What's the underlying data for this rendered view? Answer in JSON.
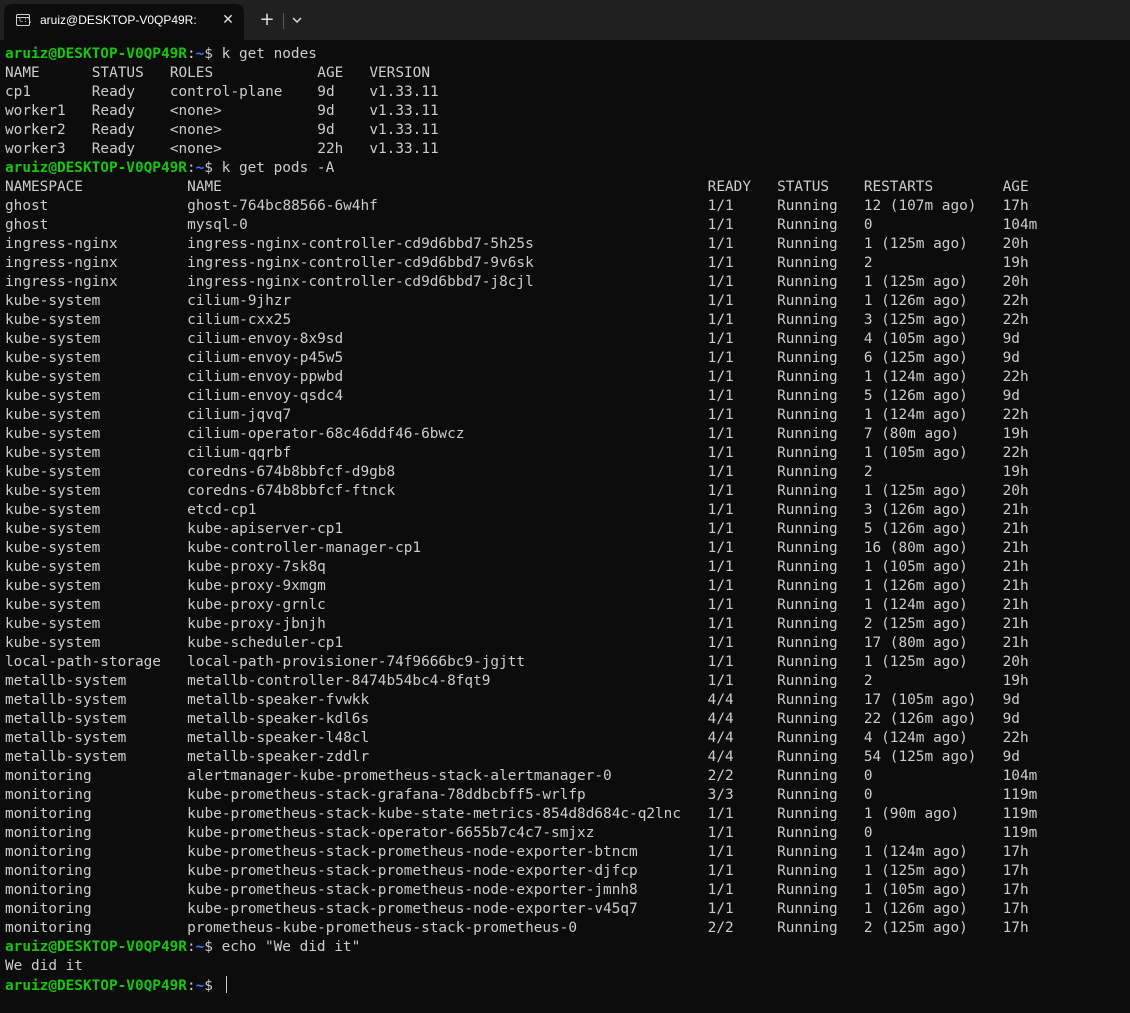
{
  "window": {
    "tab_title": "aruiz@DESKTOP-V0QP49R: ~",
    "tab_close": "✕",
    "new_tab": "+",
    "tab_icon_glyph": "C:\\"
  },
  "prompt": {
    "user_host": "aruiz@DESKTOP-V0QP49R",
    "path": "~",
    "symbol": "$ "
  },
  "commands": [
    "k get nodes",
    "k get pods -A",
    "echo \"We did it\""
  ],
  "nodes_table": {
    "headers": [
      "NAME",
      "STATUS",
      "ROLES",
      "AGE",
      "VERSION"
    ],
    "rows": [
      [
        "cp1",
        "Ready",
        "control-plane",
        "9d",
        "v1.33.11"
      ],
      [
        "worker1",
        "Ready",
        "<none>",
        "9d",
        "v1.33.11"
      ],
      [
        "worker2",
        "Ready",
        "<none>",
        "9d",
        "v1.33.11"
      ],
      [
        "worker3",
        "Ready",
        "<none>",
        "22h",
        "v1.33.11"
      ]
    ]
  },
  "pods_table": {
    "headers": [
      "NAMESPACE",
      "NAME",
      "READY",
      "STATUS",
      "RESTARTS",
      "AGE"
    ],
    "rows": [
      [
        "ghost",
        "ghost-764bc88566-6w4hf",
        "1/1",
        "Running",
        "12 (107m ago)",
        "17h"
      ],
      [
        "ghost",
        "mysql-0",
        "1/1",
        "Running",
        "0",
        "104m"
      ],
      [
        "ingress-nginx",
        "ingress-nginx-controller-cd9d6bbd7-5h25s",
        "1/1",
        "Running",
        "1 (125m ago)",
        "20h"
      ],
      [
        "ingress-nginx",
        "ingress-nginx-controller-cd9d6bbd7-9v6sk",
        "1/1",
        "Running",
        "2",
        "19h"
      ],
      [
        "ingress-nginx",
        "ingress-nginx-controller-cd9d6bbd7-j8cjl",
        "1/1",
        "Running",
        "1 (125m ago)",
        "20h"
      ],
      [
        "kube-system",
        "cilium-9jhzr",
        "1/1",
        "Running",
        "1 (126m ago)",
        "22h"
      ],
      [
        "kube-system",
        "cilium-cxx25",
        "1/1",
        "Running",
        "3 (125m ago)",
        "22h"
      ],
      [
        "kube-system",
        "cilium-envoy-8x9sd",
        "1/1",
        "Running",
        "4 (105m ago)",
        "9d"
      ],
      [
        "kube-system",
        "cilium-envoy-p45w5",
        "1/1",
        "Running",
        "6 (125m ago)",
        "9d"
      ],
      [
        "kube-system",
        "cilium-envoy-ppwbd",
        "1/1",
        "Running",
        "1 (124m ago)",
        "22h"
      ],
      [
        "kube-system",
        "cilium-envoy-qsdc4",
        "1/1",
        "Running",
        "5 (126m ago)",
        "9d"
      ],
      [
        "kube-system",
        "cilium-jqvq7",
        "1/1",
        "Running",
        "1 (124m ago)",
        "22h"
      ],
      [
        "kube-system",
        "cilium-operator-68c46ddf46-6bwcz",
        "1/1",
        "Running",
        "7 (80m ago)",
        "19h"
      ],
      [
        "kube-system",
        "cilium-qqrbf",
        "1/1",
        "Running",
        "1 (105m ago)",
        "22h"
      ],
      [
        "kube-system",
        "coredns-674b8bbfcf-d9gb8",
        "1/1",
        "Running",
        "2",
        "19h"
      ],
      [
        "kube-system",
        "coredns-674b8bbfcf-ftnck",
        "1/1",
        "Running",
        "1 (125m ago)",
        "20h"
      ],
      [
        "kube-system",
        "etcd-cp1",
        "1/1",
        "Running",
        "3 (126m ago)",
        "21h"
      ],
      [
        "kube-system",
        "kube-apiserver-cp1",
        "1/1",
        "Running",
        "5 (126m ago)",
        "21h"
      ],
      [
        "kube-system",
        "kube-controller-manager-cp1",
        "1/1",
        "Running",
        "16 (80m ago)",
        "21h"
      ],
      [
        "kube-system",
        "kube-proxy-7sk8q",
        "1/1",
        "Running",
        "1 (105m ago)",
        "21h"
      ],
      [
        "kube-system",
        "kube-proxy-9xmgm",
        "1/1",
        "Running",
        "1 (126m ago)",
        "21h"
      ],
      [
        "kube-system",
        "kube-proxy-grnlc",
        "1/1",
        "Running",
        "1 (124m ago)",
        "21h"
      ],
      [
        "kube-system",
        "kube-proxy-jbnjh",
        "1/1",
        "Running",
        "2 (125m ago)",
        "21h"
      ],
      [
        "kube-system",
        "kube-scheduler-cp1",
        "1/1",
        "Running",
        "17 (80m ago)",
        "21h"
      ],
      [
        "local-path-storage",
        "local-path-provisioner-74f9666bc9-jgjtt",
        "1/1",
        "Running",
        "1 (125m ago)",
        "20h"
      ],
      [
        "metallb-system",
        "metallb-controller-8474b54bc4-8fqt9",
        "1/1",
        "Running",
        "2",
        "19h"
      ],
      [
        "metallb-system",
        "metallb-speaker-fvwkk",
        "4/4",
        "Running",
        "17 (105m ago)",
        "9d"
      ],
      [
        "metallb-system",
        "metallb-speaker-kdl6s",
        "4/4",
        "Running",
        "22 (126m ago)",
        "9d"
      ],
      [
        "metallb-system",
        "metallb-speaker-l48cl",
        "4/4",
        "Running",
        "4 (124m ago)",
        "22h"
      ],
      [
        "metallb-system",
        "metallb-speaker-zddlr",
        "4/4",
        "Running",
        "54 (125m ago)",
        "9d"
      ],
      [
        "monitoring",
        "alertmanager-kube-prometheus-stack-alertmanager-0",
        "2/2",
        "Running",
        "0",
        "104m"
      ],
      [
        "monitoring",
        "kube-prometheus-stack-grafana-78ddbcbff5-wrlfp",
        "3/3",
        "Running",
        "0",
        "119m"
      ],
      [
        "monitoring",
        "kube-prometheus-stack-kube-state-metrics-854d8d684c-q2lnc",
        "1/1",
        "Running",
        "1 (90m ago)",
        "119m"
      ],
      [
        "monitoring",
        "kube-prometheus-stack-operator-6655b7c4c7-smjxz",
        "1/1",
        "Running",
        "0",
        "119m"
      ],
      [
        "monitoring",
        "kube-prometheus-stack-prometheus-node-exporter-btncm",
        "1/1",
        "Running",
        "1 (124m ago)",
        "17h"
      ],
      [
        "monitoring",
        "kube-prometheus-stack-prometheus-node-exporter-djfcp",
        "1/1",
        "Running",
        "1 (125m ago)",
        "17h"
      ],
      [
        "monitoring",
        "kube-prometheus-stack-prometheus-node-exporter-jmnh8",
        "1/1",
        "Running",
        "1 (105m ago)",
        "17h"
      ],
      [
        "monitoring",
        "kube-prometheus-stack-prometheus-node-exporter-v45q7",
        "1/1",
        "Running",
        "1 (126m ago)",
        "17h"
      ],
      [
        "monitoring",
        "prometheus-kube-prometheus-stack-prometheus-0",
        "2/2",
        "Running",
        "2 (125m ago)",
        "17h"
      ]
    ]
  },
  "echo_output": "We did it"
}
